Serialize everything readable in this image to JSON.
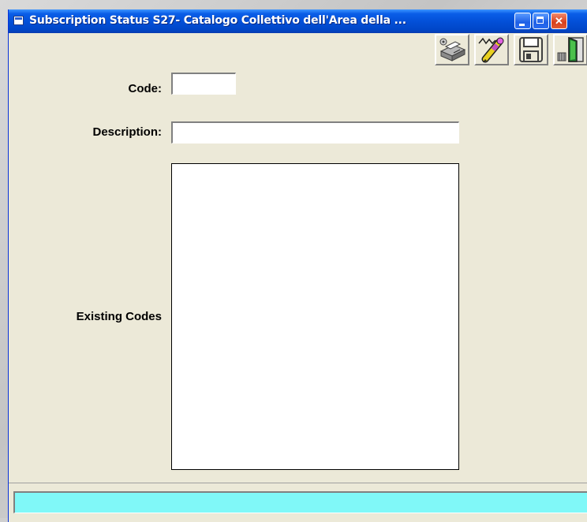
{
  "window": {
    "title": "Subscription Status S27- Catalogo Collettivo dell'Area della ...",
    "buttons": {
      "minimize": "minimize",
      "maximize": "maximize",
      "close": "✕"
    }
  },
  "toolbar": {
    "icons": [
      "printer-icon",
      "edit-pen-icon",
      "save-disk-icon",
      "exit-door-icon"
    ]
  },
  "form": {
    "code_label": "Code:",
    "code_value": "",
    "description_label": "Description:",
    "description_value": "",
    "existing_codes_label": "Existing Codes",
    "existing_codes": []
  },
  "status": {
    "text": ""
  },
  "colors": {
    "titlebar": "#0350d8",
    "window_bg": "#ece9d8",
    "status_bg": "#80f8f8",
    "close_button": "#d8401c"
  }
}
